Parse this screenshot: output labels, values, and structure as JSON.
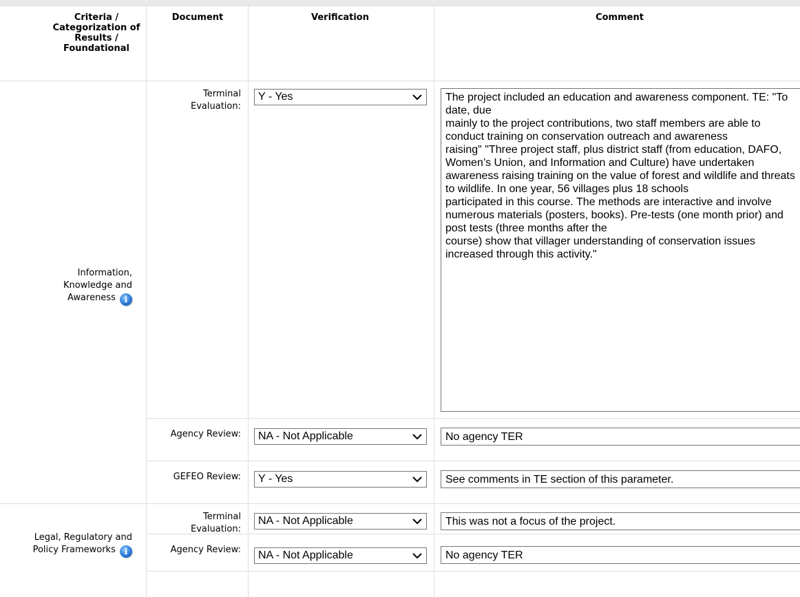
{
  "table": {
    "headers": {
      "criteria": "Criteria / Categorization of Results / Foundational",
      "document": "Document",
      "verification": "Verification",
      "comment": "Comment"
    },
    "groups": [
      {
        "criteria": "Information, Knowledge and Awareness",
        "icon": "info-icon",
        "rows": [
          {
            "document": "Terminal Evaluation:",
            "verification": "Y - Yes",
            "comment": "The project included an education and awareness component. TE: \"To date, due\nmainly to the project contributions, two staff members are able to conduct training on conservation outreach and awareness\nraising\" \"Three project staff, plus district staff (from education, DAFO, Women’s Union, and Information and Culture) have undertaken awareness raising training on the value of forest and wildlife and threats to wildlife.  In one year, 56 villages plus 18 schools\nparticipated in this course.  The methods are interactive and involve numerous materials (posters, books).  Pre-tests (one month prior) and post tests (three months after the\ncourse) show that villager understanding of conservation issues increased through this activity.\""
          },
          {
            "document": "Agency Review:",
            "verification": "NA - Not Applicable",
            "comment": "No agency TER"
          },
          {
            "document": "GEFEO Review:",
            "verification": "Y - Yes",
            "comment": "See comments in TE section of this parameter."
          }
        ]
      },
      {
        "criteria": "Legal, Regulatory and Policy Frameworks",
        "icon": "info-icon",
        "rows": [
          {
            "document": "Terminal Evaluation:",
            "verification": "NA - Not Applicable",
            "comment": "This was not a focus of the project."
          },
          {
            "document": "Agency Review:",
            "verification": "NA - Not Applicable",
            "comment": "No agency TER"
          }
        ]
      }
    ]
  }
}
